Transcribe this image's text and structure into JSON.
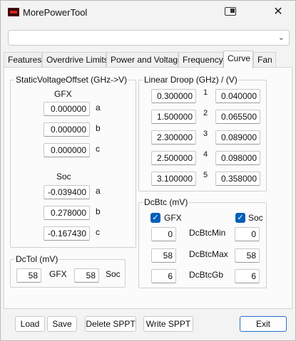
{
  "window": {
    "title": "MorePowerTool"
  },
  "dropdown": {
    "value": ""
  },
  "tabs": [
    {
      "label": "Features"
    },
    {
      "label": "Overdrive Limits"
    },
    {
      "label": "Power and Voltage"
    },
    {
      "label": "Frequency"
    },
    {
      "label": "Curve"
    },
    {
      "label": "Fan"
    }
  ],
  "active_tab": "Curve",
  "svo": {
    "title": "StaticVoltageOffset (GHz->V)",
    "gfx_label": "GFX",
    "soc_label": "Soc",
    "gfx": [
      {
        "value": "0.000000",
        "coef": "a"
      },
      {
        "value": "0.000000",
        "coef": "b"
      },
      {
        "value": "0.000000",
        "coef": "c"
      }
    ],
    "soc": [
      {
        "value": "-0.039400",
        "coef": "a"
      },
      {
        "value": "0.278000",
        "coef": "b"
      },
      {
        "value": "-0.167430",
        "coef": "c"
      }
    ]
  },
  "droop": {
    "title": "Linear Droop (GHz) / (V)",
    "rows": [
      {
        "ghz": "0.300000",
        "idx": "1",
        "v": "0.040000"
      },
      {
        "ghz": "1.500000",
        "idx": "2",
        "v": "0.065500"
      },
      {
        "ghz": "2.300000",
        "idx": "3",
        "v": "0.089000"
      },
      {
        "ghz": "2.500000",
        "idx": "4",
        "v": "0.098000"
      },
      {
        "ghz": "3.100000",
        "idx": "5",
        "v": "0.358000"
      }
    ]
  },
  "dcbtc": {
    "title": "DcBtc (mV)",
    "gfx_label": "GFX",
    "soc_label": "Soc",
    "gfx_checked": true,
    "soc_checked": true,
    "rows": [
      {
        "label": "DcBtcMin",
        "gfx": "0",
        "soc": "0"
      },
      {
        "label": "DcBtcMax",
        "gfx": "58",
        "soc": "58"
      },
      {
        "label": "DcBtcGb",
        "gfx": "6",
        "soc": "6"
      }
    ]
  },
  "dctol": {
    "title": "DcTol (mV)",
    "gfx_value": "58",
    "gfx_label": "GFX",
    "soc_value": "58",
    "soc_label": "Soc"
  },
  "buttons": {
    "load": "Load",
    "save": "Save",
    "delete_sppt": "Delete SPPT",
    "write_sppt": "Write SPPT",
    "exit": "Exit"
  },
  "icons": {
    "app": "mpt-logo-icon",
    "snap": "snap-layout-icon",
    "close": "close-icon",
    "dropdown": "chevron-down-icon",
    "checkbox": "checkmark-icon"
  },
  "colors": {
    "accent": "#005fb8",
    "window_bg": "#f3f3f3",
    "panel_bg": "#fbfbfb",
    "exit_border": "#2a6fc9",
    "logo_red": "#e0201c"
  }
}
